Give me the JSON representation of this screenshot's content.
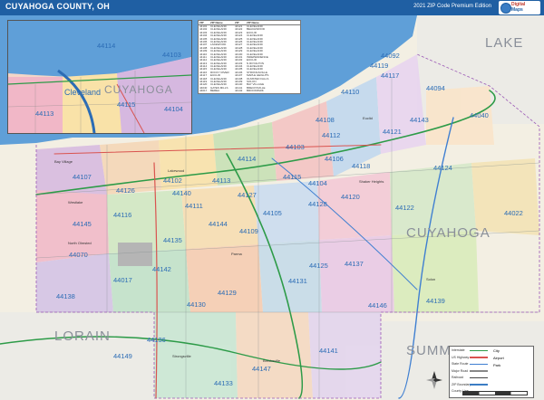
{
  "header": {
    "title": "CUYAHOGA COUNTY, OH",
    "edition": "2021 ZIP Code Premium Edition"
  },
  "map": {
    "water_color": "#5f9fd8",
    "zip_label_color": "#2b6cb5",
    "county_labels": [
      "LAKE",
      "CUYAHOGA",
      "LORAIN",
      "SUMMIT"
    ],
    "zip_labels": [
      "44107",
      "44102",
      "44113",
      "44114",
      "44103",
      "44115",
      "44104",
      "44110",
      "44119",
      "44117",
      "44143",
      "44092",
      "44094",
      "44040",
      "44108",
      "44112",
      "44121",
      "44118",
      "44124",
      "44120",
      "44106",
      "44105",
      "44128",
      "44122",
      "44022",
      "44127",
      "44111",
      "44135",
      "44109",
      "44144",
      "44129",
      "44130",
      "44131",
      "44125",
      "44137",
      "44146",
      "44139",
      "44133",
      "44141",
      "44147",
      "44149",
      "44136",
      "44138",
      "44142",
      "44017",
      "44070",
      "44116",
      "44126",
      "44145",
      "44140"
    ],
    "city_labels": [
      "Lakewood",
      "Westlake",
      "Parma",
      "Solon",
      "Strongsville",
      "Euclid",
      "Shaker Heights",
      "Brecksville",
      "North Olmsted",
      "Bay Village"
    ]
  },
  "inset": {
    "label_city": "Cleveland",
    "label_county": "CUYAHOGA",
    "zip_labels": [
      "44114",
      "44103",
      "44113",
      "44115",
      "44104"
    ]
  },
  "zip_table": {
    "headers": [
      "ZIP",
      "ZIP Name",
      "ZIP",
      "ZIP Name"
    ],
    "rows": [
      [
        "44101",
        "CLEVELAND",
        "44121",
        "CLEVELAND"
      ],
      [
        "44102",
        "CLEVELAND",
        "44122",
        "BEACHWOOD"
      ],
      [
        "44103",
        "CLEVELAND",
        "44123",
        "EUCLID"
      ],
      [
        "44104",
        "CLEVELAND",
        "44124",
        "CLEVELAND"
      ],
      [
        "44105",
        "CLEVELAND",
        "44125",
        "CLEVELAND"
      ],
      [
        "44106",
        "CLEVELAND",
        "44126",
        "CLEVELAND"
      ],
      [
        "44107",
        "LAKEWOOD",
        "44127",
        "CLEVELAND"
      ],
      [
        "44108",
        "CLEVELAND",
        "44128",
        "CLEVELAND"
      ],
      [
        "44109",
        "CLEVELAND",
        "44129",
        "CLEVELAND"
      ],
      [
        "44110",
        "CLEVELAND",
        "44130",
        "CLEVELAND"
      ],
      [
        "44111",
        "CLEVELAND",
        "44131",
        "INDEPENDENCE"
      ],
      [
        "44112",
        "CLEVELAND",
        "44132",
        "EUCLID"
      ],
      [
        "44113",
        "CLEVELAND",
        "44133",
        "N ROYALTON"
      ],
      [
        "44114",
        "CLEVELAND",
        "44134",
        "CLEVELAND"
      ],
      [
        "44115",
        "CLEVELAND",
        "44135",
        "CLEVELAND"
      ],
      [
        "44116",
        "ROCKY RIVER",
        "44136",
        "STRONGSVILLE"
      ],
      [
        "44117",
        "EUCLID",
        "44137",
        "MAPLE HEIGHTS"
      ],
      [
        "44118",
        "CLEVELAND",
        "44138",
        "OLMSTED FALLS"
      ],
      [
        "44119",
        "CLEVELAND",
        "44139",
        "SOLON"
      ],
      [
        "44120",
        "CLEVELAND",
        "44140",
        "BAY VILLAGE"
      ],
      [
        "44040",
        "GATES MILLS",
        "44141",
        "BRECKSVILLE"
      ],
      [
        "44017",
        "BEREA",
        "44142",
        "BROOKPARK"
      ]
    ]
  },
  "legend": {
    "items": [
      {
        "label": "Interstate",
        "color": "#2d9b48"
      },
      {
        "label": "US Highway",
        "color": "#d9534f"
      },
      {
        "label": "State Route",
        "color": "#3f7fd1"
      },
      {
        "label": "Major Road",
        "color": "#888888"
      },
      {
        "label": "Railroad",
        "color": "#444444"
      },
      {
        "label": "ZIP Boundary",
        "color": "#3b7dc4"
      },
      {
        "label": "County Line",
        "color": "#9b59b6"
      }
    ],
    "symbols": [
      "City",
      "Airport",
      "Park"
    ]
  },
  "brand": {
    "line1": "Digital",
    "line2": "Maps"
  }
}
